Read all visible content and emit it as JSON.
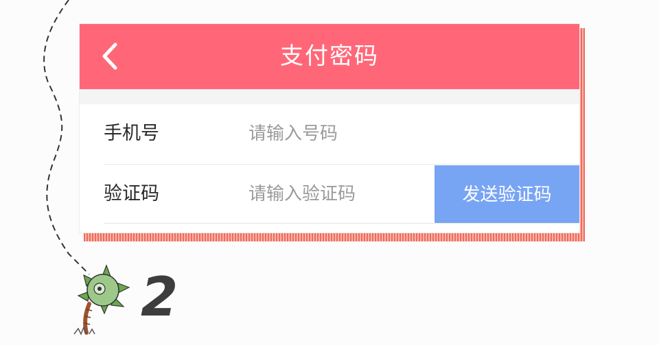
{
  "header": {
    "title": "支付密码",
    "back_icon": "chevron-left-icon"
  },
  "form": {
    "phone": {
      "label": "手机号",
      "placeholder": "请输入号码",
      "value": ""
    },
    "code": {
      "label": "验证码",
      "placeholder": "请输入验证码",
      "value": ""
    },
    "send_code_label": "发送验证码"
  },
  "decoration": {
    "step_number": "2",
    "mascot_icon": "spiky-flower-mascot-icon"
  },
  "colors": {
    "header_bg": "#ff6778",
    "send_button_bg": "#78a4f4",
    "stripe_accent": "#f06a5f"
  }
}
